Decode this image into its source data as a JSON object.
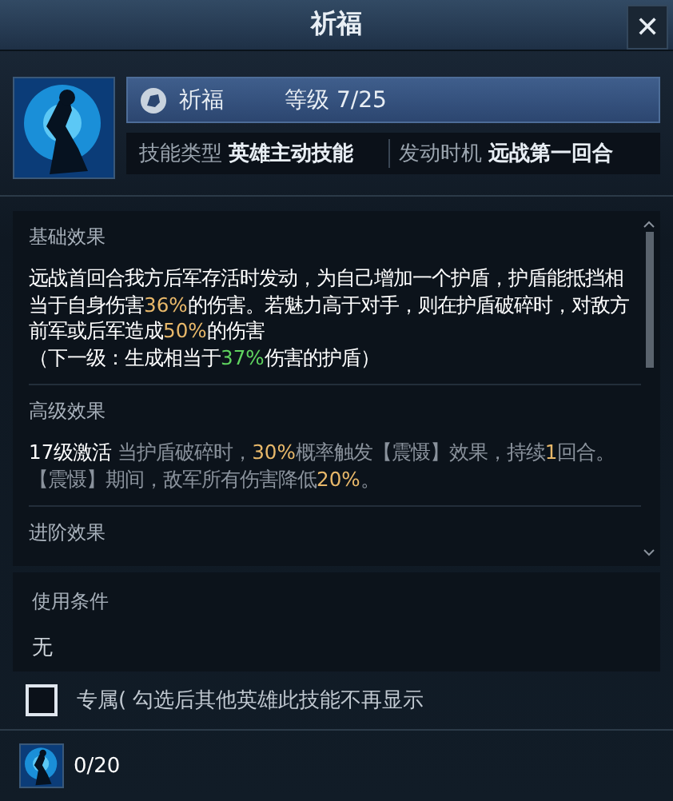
{
  "window": {
    "title": "祈福",
    "close": "✕"
  },
  "skill": {
    "name": "祈福",
    "level_label": "等级",
    "level": "7/25",
    "type_label": "技能类型",
    "type": "英雄主动技能",
    "trigger_label": "发动时机",
    "trigger": "远战第一回合"
  },
  "sections": [
    {
      "title": "基础效果",
      "paragraphs": [
        [
          {
            "text": "远战首回合我方后军存活时发动，为自己增加一个护盾，护盾能抵挡相当于自身伤害",
            "color": "#ffffff"
          },
          {
            "text": "36%",
            "color": "#e8b86a"
          },
          {
            "text": "的伤害。若魅力高于对手，则在护盾破碎时，对敌方前军或后军造成",
            "color": "#ffffff"
          },
          {
            "text": "50%",
            "color": "#e8b86a"
          },
          {
            "text": "的伤害",
            "color": "#ffffff"
          }
        ],
        [
          {
            "text": "（下一级：生成相当于",
            "color": "#ffffff"
          },
          {
            "text": "37%",
            "color": "#5fd35f"
          },
          {
            "text": "伤害的护盾）",
            "color": "#ffffff"
          }
        ]
      ]
    },
    {
      "title": "高级效果",
      "paragraphs": [
        [
          {
            "text": "17级激活 ",
            "color": "#ffffff"
          },
          {
            "text": "当护盾破碎时，",
            "color": "#8a929c"
          },
          {
            "text": "30%",
            "color": "#e8b86a"
          },
          {
            "text": "概率触发【震慑】效果，持续",
            "color": "#8a929c"
          },
          {
            "text": "1",
            "color": "#e8b86a"
          },
          {
            "text": "回合。【震慑】期间，敌军所有伤害降低",
            "color": "#8a929c"
          },
          {
            "text": "20%",
            "color": "#e8b86a"
          },
          {
            "text": "。",
            "color": "#8a929c"
          }
        ]
      ]
    },
    {
      "title": "进阶效果"
    }
  ],
  "condition": {
    "title": "使用条件",
    "value": "无"
  },
  "exclusive": {
    "label": "专属( 勾选后其他英雄此技能不再显示",
    "checked": false
  },
  "footer": {
    "count": "0/20"
  }
}
